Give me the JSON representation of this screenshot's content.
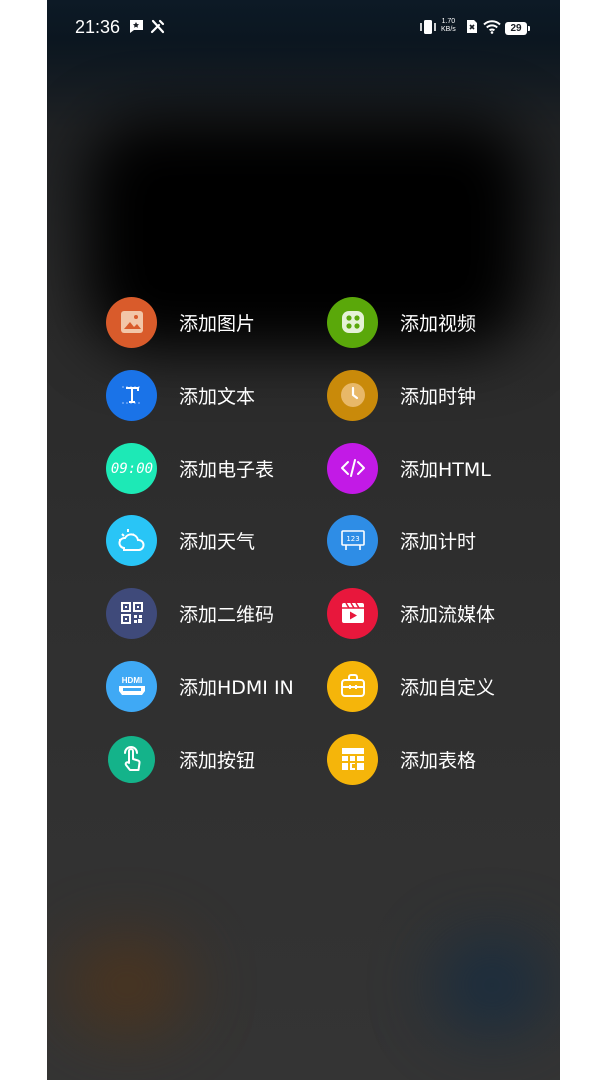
{
  "status_bar": {
    "time": "21:36",
    "network_speed_value": "1.70",
    "network_speed_unit": "KB/s",
    "battery_level": "29"
  },
  "menu": {
    "left_items": [
      {
        "label": "添加图片",
        "icon": "image-icon",
        "color": "#d95b2b"
      },
      {
        "label": "添加文本",
        "icon": "text-icon",
        "color": "#1a73e8"
      },
      {
        "label": "添加电子表",
        "icon": "digital-clock-icon",
        "color": "#1de9b6"
      },
      {
        "label": "添加天气",
        "icon": "weather-icon",
        "color": "#29c5f6"
      },
      {
        "label": "添加二维码",
        "icon": "qr-code-icon",
        "color": "#3f4a7a"
      },
      {
        "label": "添加HDMI IN",
        "icon": "hdmi-icon",
        "color": "#3fa9f5"
      },
      {
        "label": "添加按钮",
        "icon": "touch-button-icon",
        "color": "#14b38a"
      }
    ],
    "right_items": [
      {
        "label": "添加视频",
        "icon": "video-icon",
        "color": "#5aa80a"
      },
      {
        "label": "添加时钟",
        "icon": "clock-icon",
        "color": "#c98a0a"
      },
      {
        "label": "添加HTML",
        "icon": "html-code-icon",
        "color": "#c21ae6"
      },
      {
        "label": "添加计时",
        "icon": "timer-icon",
        "color": "#2e8de6"
      },
      {
        "label": "添加流媒体",
        "icon": "streaming-icon",
        "color": "#e8173c"
      },
      {
        "label": "添加自定义",
        "icon": "custom-icon",
        "color": "#f5b50a"
      },
      {
        "label": "添加表格",
        "icon": "table-icon",
        "color": "#f5b50a"
      }
    ]
  }
}
